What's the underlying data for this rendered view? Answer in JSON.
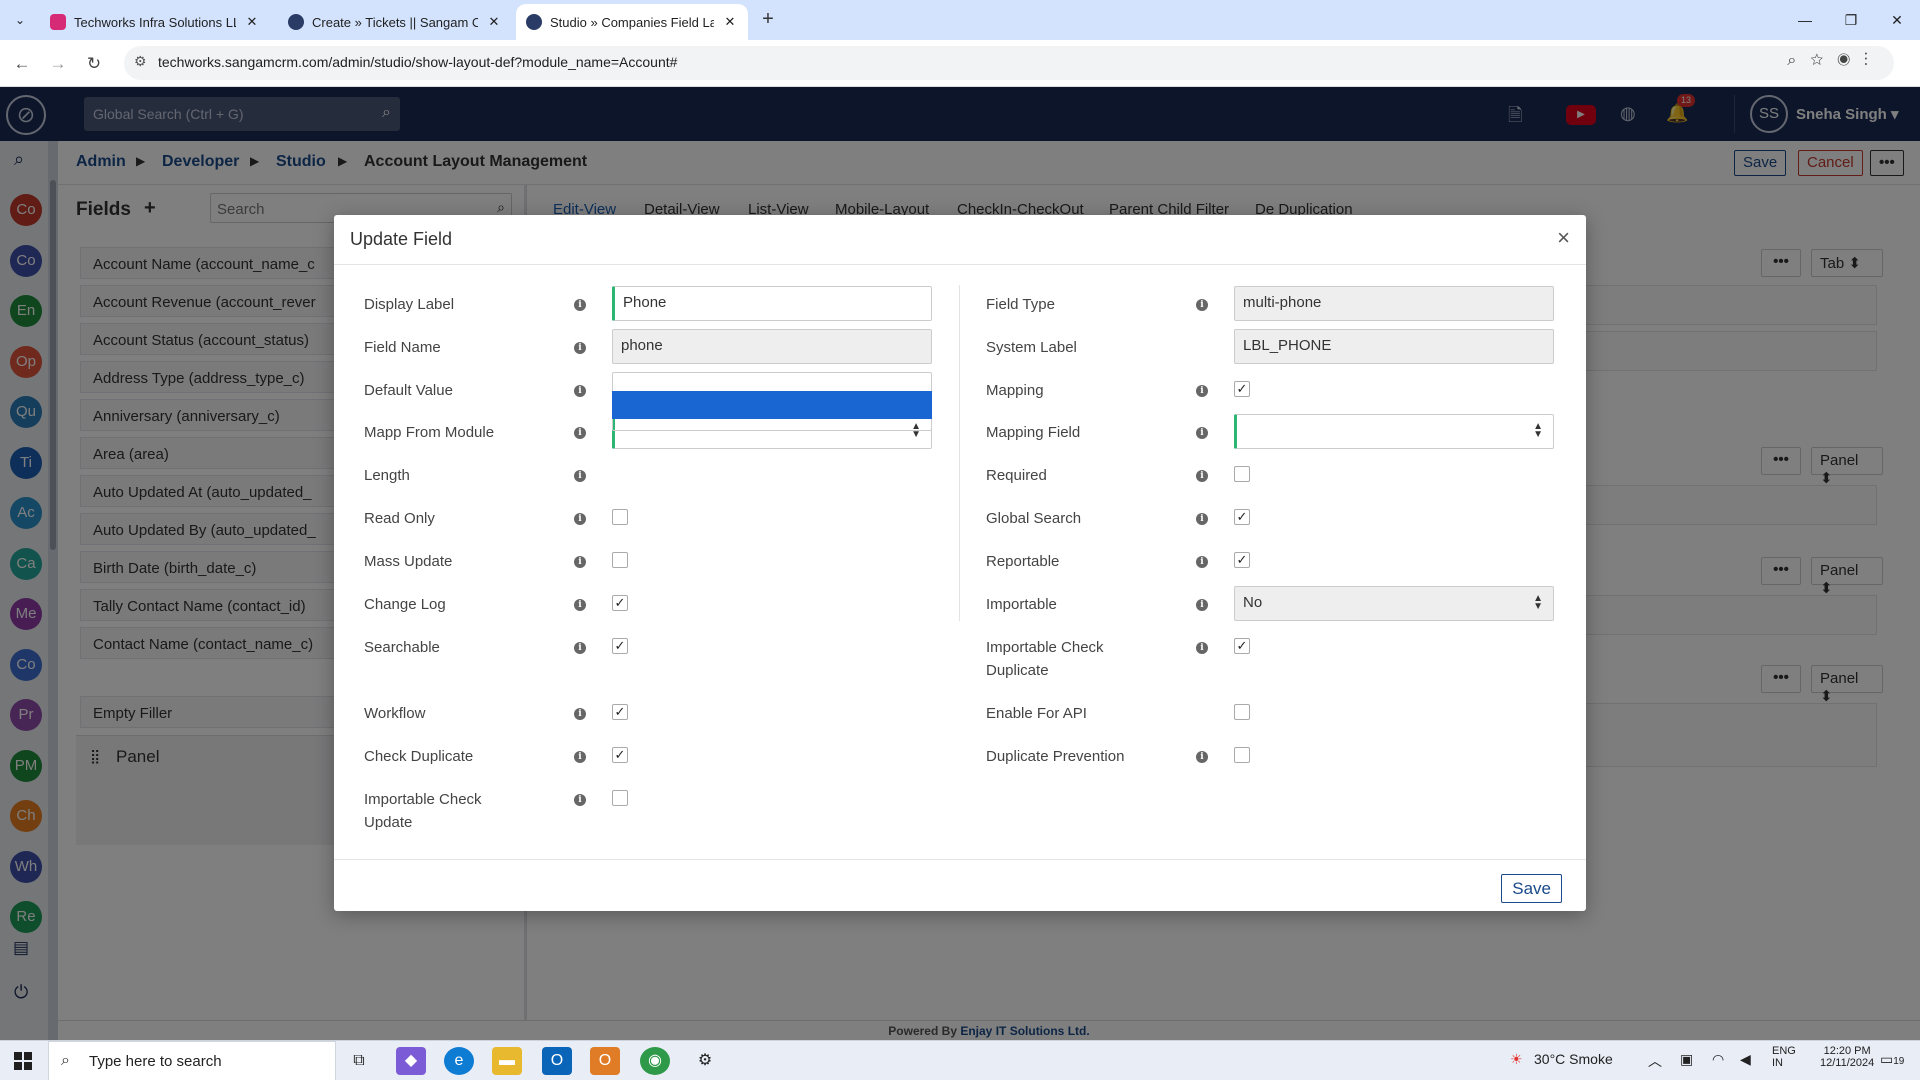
{
  "browser": {
    "tabs": [
      {
        "title": "Techworks Infra Solutions LLP (",
        "favicon": "instagram-icon",
        "color": "#d62976"
      },
      {
        "title": "Create » Tickets || Sangam CRM",
        "favicon": "sangam-icon",
        "color": "#2a3b66"
      },
      {
        "title": "Studio » Companies Field Layou",
        "favicon": "sangam-icon",
        "color": "#2a3b66"
      }
    ],
    "url": "techworks.sangamcrm.com/admin/studio/show-layout-def?module_name=Account#"
  },
  "app": {
    "search_placeholder": "Global Search (Ctrl + G)",
    "notification_count": "13",
    "user_initials": "SS",
    "user_name": "Sneha Singh"
  },
  "rail": [
    {
      "label": "Co",
      "color": "#c0392b"
    },
    {
      "label": "Co",
      "color": "#3f4fa8"
    },
    {
      "label": "En",
      "color": "#1e8c3a"
    },
    {
      "label": "Op",
      "color": "#e0533b"
    },
    {
      "label": "Qu",
      "color": "#2b7bb9"
    },
    {
      "label": "Ti",
      "color": "#1a5fb4"
    },
    {
      "label": "Ac",
      "color": "#2b90c9"
    },
    {
      "label": "Ca",
      "color": "#26a69a"
    },
    {
      "label": "Me",
      "color": "#8e3aa9"
    },
    {
      "label": "Co",
      "color": "#3f6fd1"
    },
    {
      "label": "Pr",
      "color": "#8e4ba9"
    },
    {
      "label": "PM",
      "color": "#1e8c3a"
    },
    {
      "label": "Ch",
      "color": "#e67e22"
    },
    {
      "label": "Wh",
      "color": "#3f4fa8"
    },
    {
      "label": "Re",
      "color": "#1e9c5a"
    }
  ],
  "breadcrumb": {
    "items": [
      "Admin",
      "Developer",
      "Studio"
    ],
    "current": "Account Layout Management",
    "save": "Save",
    "cancel": "Cancel"
  },
  "fields_panel": {
    "title": "Fields",
    "search_placeholder": "Search",
    "items": [
      "Account Name (account_name_c",
      "Account Revenue (account_rever",
      "Account Status (account_status)",
      "Address Type (address_type_c)",
      "Anniversary (anniversary_c)",
      "Area (area)",
      "Auto Updated At (auto_updated_",
      "Auto Updated By (auto_updated_",
      "Birth Date (birth_date_c)",
      "Tally Contact Name (contact_id)",
      "Contact Name (contact_name_c)"
    ],
    "filler": "Empty Filler",
    "panel": "Panel"
  },
  "layout_tabs": [
    "Edit-View",
    "Detail-View",
    "List-View",
    "Mobile-Layout",
    "CheckIn-CheckOut",
    "Parent Child Filter",
    "De Duplication"
  ],
  "layout_selects": [
    "Tab",
    "Panel",
    "Panel",
    "Panel"
  ],
  "modal": {
    "title": "Update Field",
    "left": {
      "display_label": {
        "label": "Display Label",
        "value": "Phone"
      },
      "field_name": {
        "label": "Field Name",
        "value": "phone"
      },
      "default_value": {
        "label": "Default Value",
        "value": ""
      },
      "mapp_from_module": {
        "label": "Mapp From Module",
        "value": ""
      },
      "length": {
        "label": "Length"
      },
      "read_only": {
        "label": "Read Only",
        "checked": false
      },
      "mass_update": {
        "label": "Mass Update",
        "checked": false
      },
      "change_log": {
        "label": "Change Log",
        "checked": true
      },
      "searchable": {
        "label": "Searchable",
        "checked": true
      },
      "workflow": {
        "label": "Workflow",
        "checked": true
      },
      "check_duplicate": {
        "label": "Check Duplicate",
        "checked": true
      },
      "importable_check_update": {
        "label": "Importable Check Update",
        "checked": false
      }
    },
    "right": {
      "field_type": {
        "label": "Field Type",
        "value": "multi-phone"
      },
      "system_label": {
        "label": "System Label",
        "value": "LBL_PHONE"
      },
      "mapping": {
        "label": "Mapping",
        "checked": true
      },
      "mapping_field": {
        "label": "Mapping Field",
        "value": ""
      },
      "required": {
        "label": "Required",
        "checked": false
      },
      "global_search": {
        "label": "Global Search",
        "checked": true
      },
      "reportable": {
        "label": "Reportable",
        "checked": true
      },
      "importable": {
        "label": "Importable",
        "value": "No"
      },
      "importable_check_duplicate": {
        "label": "Importable Check Duplicate",
        "checked": true
      },
      "enable_for_api": {
        "label": "Enable For API",
        "checked": false
      },
      "duplicate_prevention": {
        "label": "Duplicate Prevention",
        "checked": false
      }
    },
    "save": "Save"
  },
  "footer": {
    "prefix": "Powered By",
    "company": "Enjay IT Solutions Ltd."
  },
  "taskbar": {
    "search_placeholder": "Type here to search",
    "weather": "30°C  Smoke",
    "lang_top": "ENG",
    "lang_bottom": "IN",
    "time": "12:20 PM",
    "date": "12/11/2024",
    "notif": "19"
  }
}
